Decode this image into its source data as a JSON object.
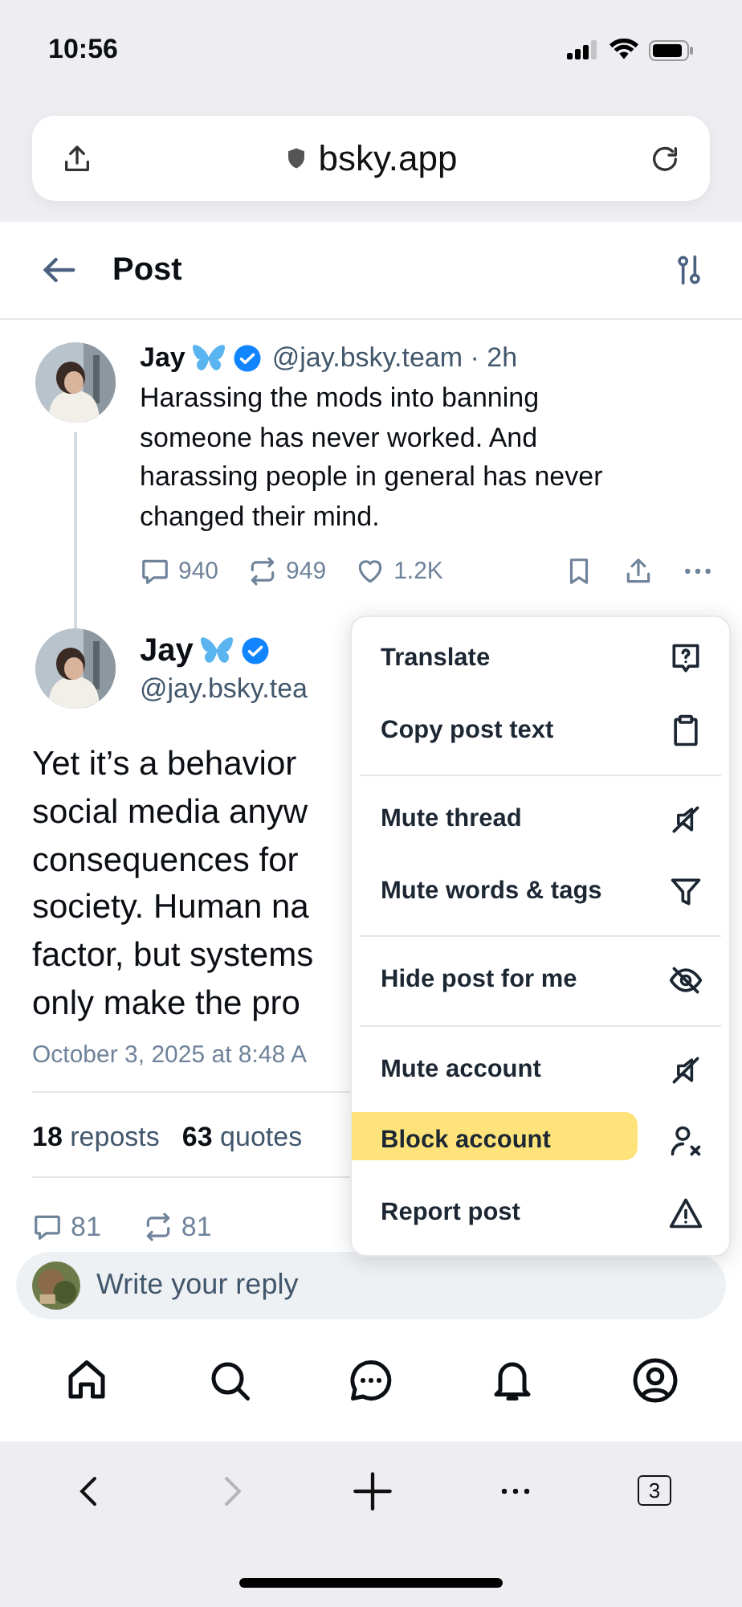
{
  "status_bar": {
    "time": "10:56"
  },
  "browser": {
    "url": "bsky.app",
    "tab_count": "3"
  },
  "header": {
    "title": "Post"
  },
  "parent_post": {
    "name": "Jay",
    "handle_time": "@jay.bsky.team · 2h",
    "text": "Harassing the mods into banning someone has never worked. And harassing people in general has never changed their mind.",
    "replies": "940",
    "reposts": "949",
    "likes": "1.2K"
  },
  "main_post": {
    "name": "Jay",
    "handle": "@jay.bsky.tea",
    "text_lines": [
      "Yet it’s a behavior",
      "social media anyw",
      "consequences for",
      "society. Human na",
      "factor, but systems",
      "only make the pro"
    ],
    "date": "October 3, 2025 at 8:48 A",
    "stats": [
      {
        "count": "18",
        "label": "reposts"
      },
      {
        "count": "63",
        "label": "quotes"
      }
    ],
    "replies": "81",
    "reposts": "81"
  },
  "menu": {
    "groups": [
      [
        {
          "label": "Translate",
          "kind": "translate",
          "highlighted": false
        },
        {
          "label": "Copy post text",
          "kind": "copy",
          "highlighted": false
        }
      ],
      [
        {
          "label": "Mute thread",
          "kind": "mute",
          "highlighted": false
        },
        {
          "label": "Mute words & tags",
          "kind": "filter",
          "highlighted": false
        }
      ],
      [
        {
          "label": "Hide post for me",
          "kind": "hide",
          "highlighted": false
        }
      ],
      [
        {
          "label": "Mute account",
          "kind": "mute",
          "highlighted": false
        },
        {
          "label": "Block account",
          "kind": "block",
          "highlighted": true
        },
        {
          "label": "Report post",
          "kind": "report",
          "highlighted": false
        }
      ]
    ]
  },
  "reply_bar": {
    "placeholder": "Write your reply"
  },
  "tab_bar": {
    "items": [
      {
        "kind": "home"
      },
      {
        "kind": "search"
      },
      {
        "kind": "chat"
      },
      {
        "kind": "bell"
      },
      {
        "kind": "profile"
      }
    ]
  }
}
